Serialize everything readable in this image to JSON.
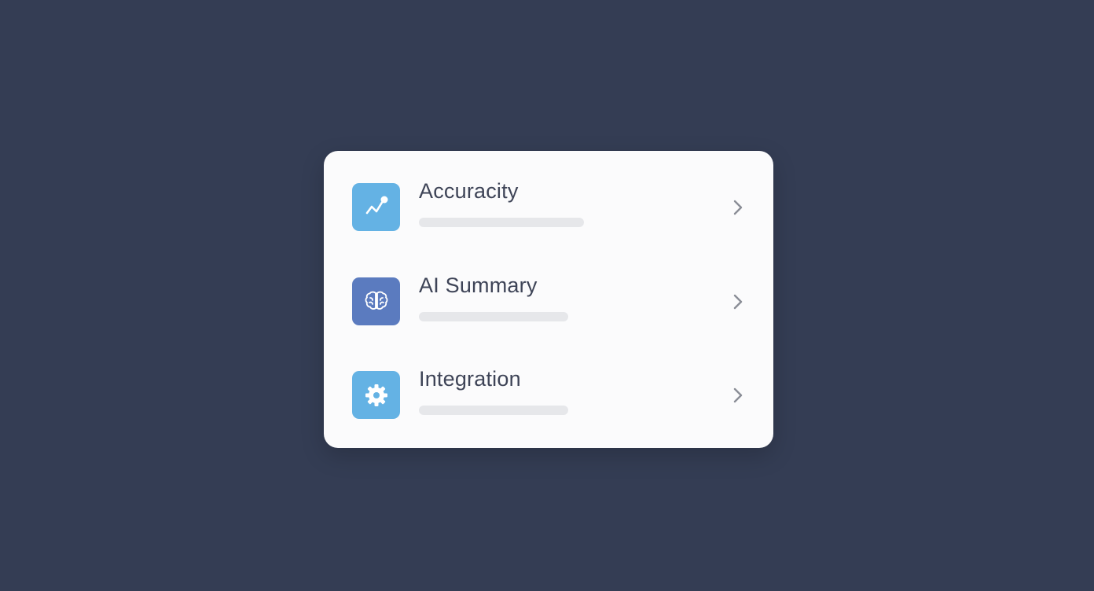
{
  "background_color": "#343d54",
  "card": {
    "background_color": "#fbfbfc",
    "items": [
      {
        "label": "Accuracity",
        "icon": "trend-line-icon",
        "icon_color": "#64b2e4",
        "action_icon": "chevron-right-icon"
      },
      {
        "label": "AI Summary",
        "icon": "brain-icon",
        "icon_color": "#5b7bbf",
        "action_icon": "chevron-right-icon"
      },
      {
        "label": "Integration",
        "icon": "gear-icon",
        "icon_color": "#64b2e4",
        "action_icon": "chevron-right-icon"
      }
    ]
  }
}
